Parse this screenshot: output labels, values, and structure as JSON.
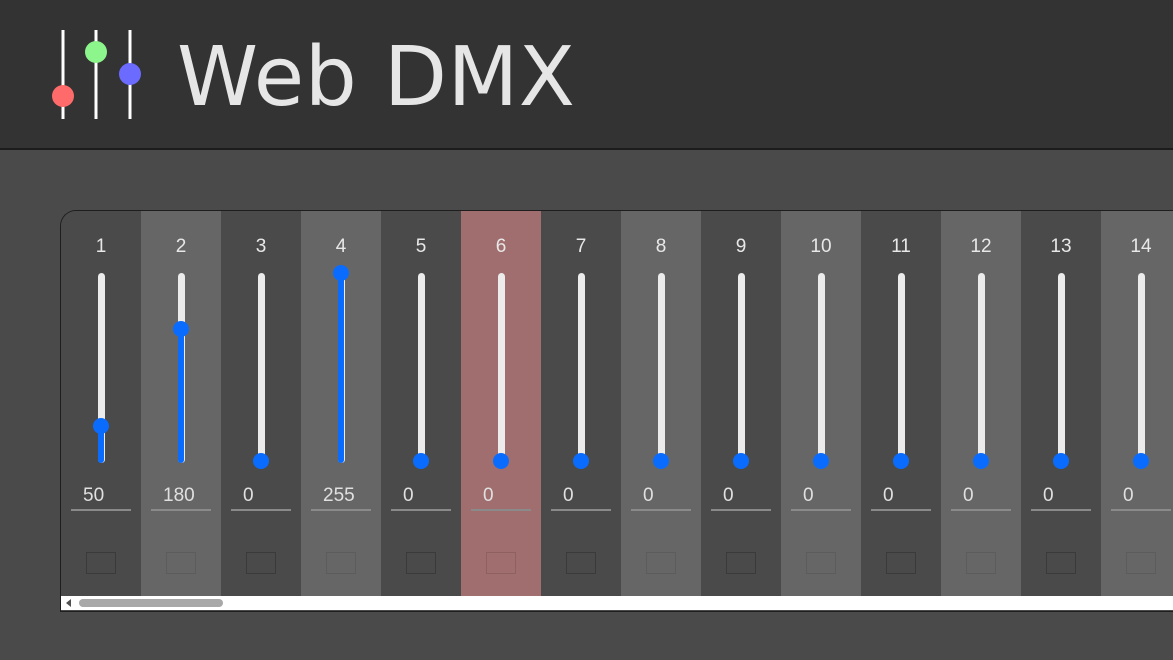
{
  "app": {
    "title": "Web DMX"
  },
  "logo": {
    "icon": "mixer-sliders-logo",
    "colors": [
      "#ff6b6b",
      "#8cf58c",
      "#6b6bff"
    ]
  },
  "colors": {
    "accent": "#0a6cff",
    "selected_channel": "#a06e6e"
  },
  "channels": [
    {
      "number": "1",
      "value": "50",
      "selected": false
    },
    {
      "number": "2",
      "value": "180",
      "selected": false
    },
    {
      "number": "3",
      "value": "0",
      "selected": false
    },
    {
      "number": "4",
      "value": "255",
      "selected": false
    },
    {
      "number": "5",
      "value": "0",
      "selected": false
    },
    {
      "number": "6",
      "value": "0",
      "selected": true
    },
    {
      "number": "7",
      "value": "0",
      "selected": false
    },
    {
      "number": "8",
      "value": "0",
      "selected": false
    },
    {
      "number": "9",
      "value": "0",
      "selected": false
    },
    {
      "number": "10",
      "value": "0",
      "selected": false
    },
    {
      "number": "11",
      "value": "0",
      "selected": false
    },
    {
      "number": "12",
      "value": "0",
      "selected": false
    },
    {
      "number": "13",
      "value": "0",
      "selected": false
    },
    {
      "number": "14",
      "value": "0",
      "selected": false
    }
  ],
  "slider_max": 255
}
